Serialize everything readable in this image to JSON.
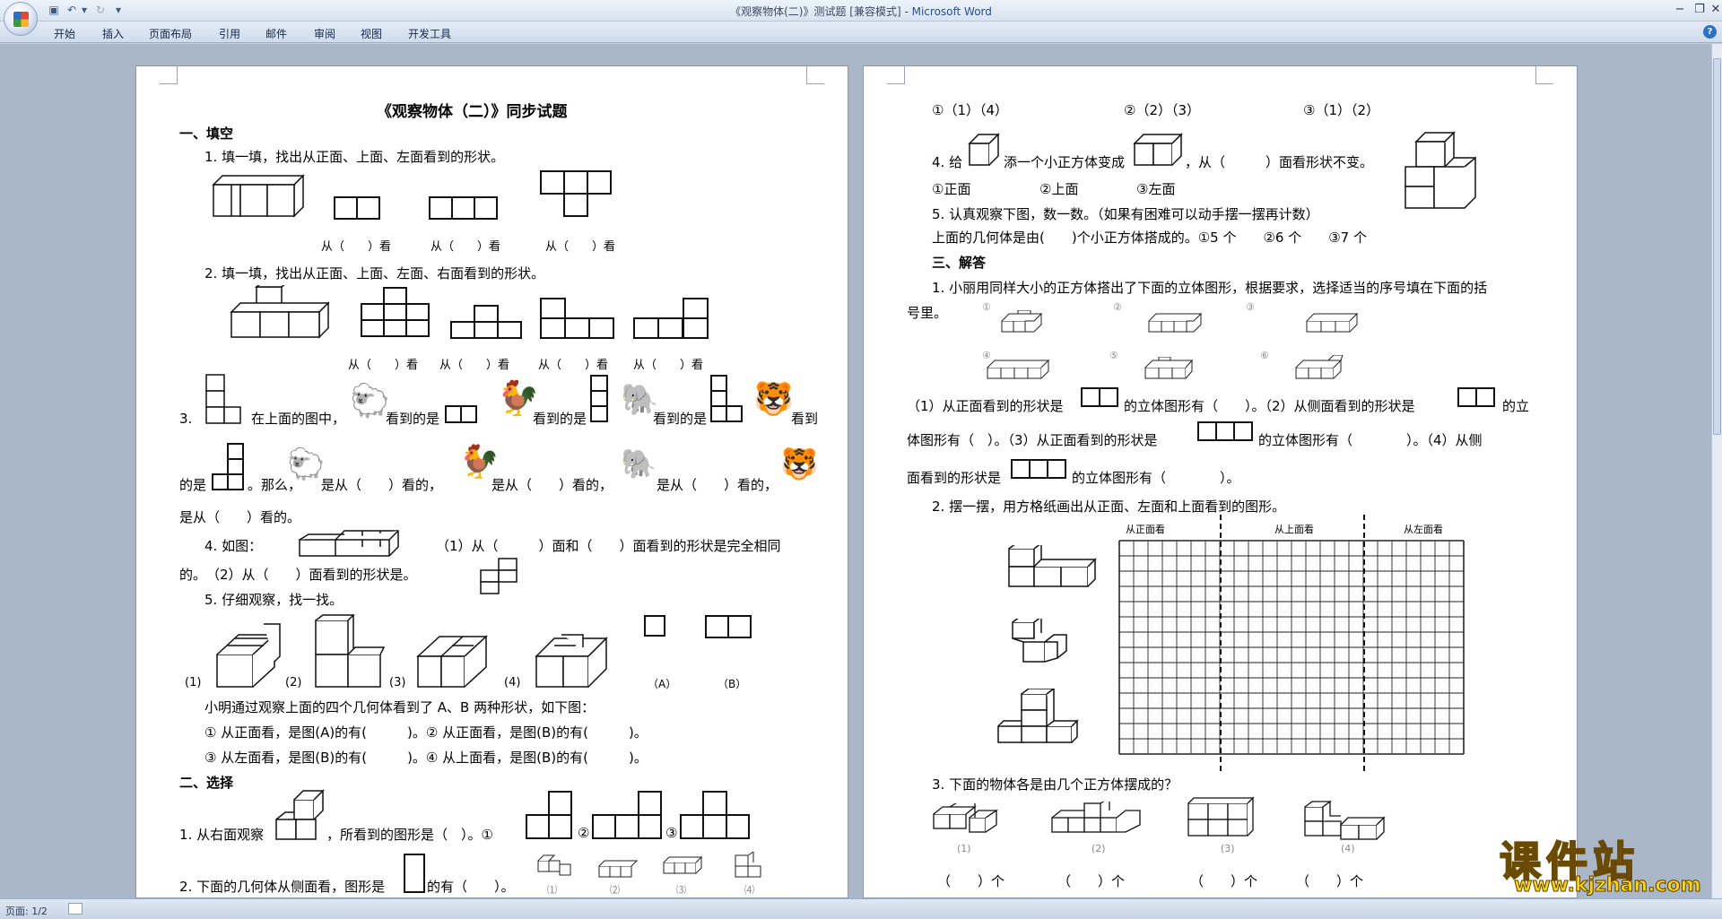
{
  "window": {
    "title": "《观察物体(二)》测试题 [兼容模式] - ",
    "app_name": "Microsoft Word"
  },
  "ribbon": {
    "tabs": [
      "开始",
      "插入",
      "页面布局",
      "引用",
      "邮件",
      "审阅",
      "视图",
      "开发工具"
    ]
  },
  "status": {
    "page": "页面: 1/2"
  },
  "page1": {
    "title": "《观察物体（二）》同步试题",
    "s1": "一、填空",
    "q1": "1. 填一填，找出从正面、上面、左面看到的形状。",
    "q1_labels": [
      "从（　　）看",
      "从（　　）看",
      "从（　　）看"
    ],
    "q2": "2. 填一填，找出从正面、上面、左面、右面看到的形状。",
    "q2_labels": [
      "从（　　）看",
      "从（　　）看",
      "从（　　）看",
      "从（　　）看"
    ],
    "q3_a": "3.",
    "q3_b": "在上面的图中，",
    "q3_c": "看到的是",
    "q3_d": "看到的是",
    "q3_e": "看到的是",
    "q3_f": "看到",
    "q3_line2_a": "的是",
    "q3_line2_b": "。那么，",
    "q3_line2_c": "是从（　　）看的，",
    "q3_line2_d": "是从（　　）看的，",
    "q3_line2_e": "是从（　　）看的，",
    "q3_line3": "是从（　　）看的。",
    "q4_a": "4. 如图：",
    "q4_b": "（1）从（　　　）面和（　　）面看到的形状是完全相同",
    "q4_c": "的。　（2）从（　　）面看到的形状是。",
    "q5": "5. 仔细观察，找一找。",
    "q5_labels": [
      "(1)",
      "(2)",
      "(3)",
      "(4)",
      "（A）",
      "（B）"
    ],
    "q5_desc": "小明通过观察上面的四个几何体看到了 A、B 两种形状，如下图：",
    "q5_l1": "① 从正面看，是图(A)的有(　　　)。② 从正面看，是图(B)的有(　　　)。",
    "q5_l2": "③ 从左面看，是图(B)的有(　　　)。④ 从上面看，是图(B)的有(　　　)。",
    "s2": "二、选择",
    "c1": "1. 从右面观察",
    "c1_b": "，所看到的图形是（　）。①",
    "c1_opts": [
      "②",
      "③"
    ],
    "c2": "2. 下面的几何体从侧面看，图形是",
    "c2_b": "的有（　　）。",
    "c2_small": [
      "⑴",
      "⑵",
      "⑶",
      "⑷"
    ]
  },
  "page2": {
    "opts_line": [
      "①（1）（4）",
      "②（2）（3）",
      "③（1）（2）"
    ],
    "q4_a": "4. 给",
    "q4_b": "添一个小正方体变成",
    "q4_c": "，从（　　　）面看形状不变。",
    "q4_opts": [
      "①正面",
      "②上面",
      "③左面"
    ],
    "q5": "5. 认真观察下图，数一数。（如果有困难可以动手摆一摆再计数）",
    "q5_b": "上面的几何体是由(　　)个小正方体搭成的。①5 个　　②6 个　　③7 个",
    "s3": "三、解答",
    "a1": "1. 小丽用同样大小的正方体搭出了下面的立体图形，根据要求，选择适当的序号填在下面的括",
    "a1_b": "号里。",
    "a1_nums": [
      "①",
      "②",
      "③",
      "④",
      "⑤",
      "⑥"
    ],
    "a1_l1_a": "（1）从正面看到的形状是",
    "a1_l1_b": "的立体图形有（　　）。（2）从侧面看到的形状是",
    "a1_l1_c": "的立",
    "a1_l2_a": "体图形有（　）。（3）从正面看到的形状是",
    "a1_l2_b": "的立体图形有（　　　　）。（4）从侧",
    "a1_l3_a": "面看到的形状是",
    "a1_l3_b": "的立体图形有（　　　　）。",
    "a2": "2. 摆一摆，用方格纸画出从正面、左面和上面看到的图形。",
    "grid_heads": [
      "从正面看",
      "从上面看",
      "从左面看"
    ],
    "a3": "3. 下面的物体各是由几个正方体摆成的？",
    "a3_nums": [
      "(1)",
      "(2)",
      "(3)",
      "(4)"
    ],
    "a3_blanks": [
      "（　　）个",
      "（　　）个",
      "（　　）个",
      "（　　）个"
    ]
  },
  "watermark": {
    "cn": "课件站",
    "url": "www.kjzhan.com"
  }
}
